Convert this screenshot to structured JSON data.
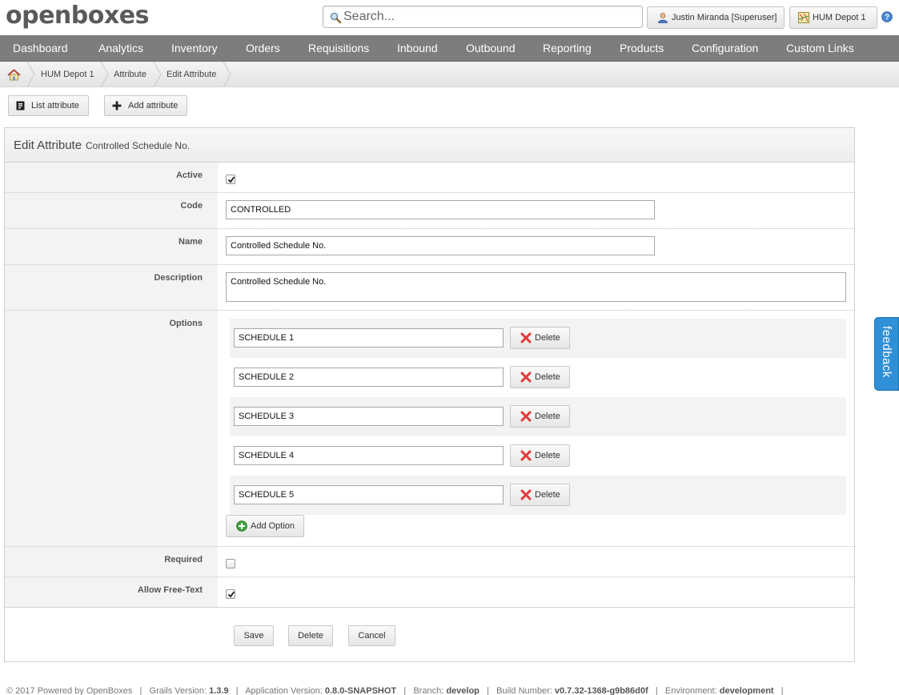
{
  "app": {
    "logo": "openboxes"
  },
  "search": {
    "placeholder": "Search..."
  },
  "header": {
    "user_label": "Justin Miranda [Superuser]",
    "location_label": "HUM Depot 1"
  },
  "nav": {
    "items": [
      "Dashboard",
      "Analytics",
      "Inventory",
      "Orders",
      "Requisitions",
      "Inbound",
      "Outbound",
      "Reporting",
      "Products",
      "Configuration",
      "Custom Links"
    ]
  },
  "breadcrumb": {
    "items": [
      "HUM Depot 1",
      "Attribute",
      "Edit Attribute"
    ]
  },
  "actions": {
    "list_label": "List attribute",
    "add_label": "Add attribute"
  },
  "form": {
    "title": "Edit Attribute",
    "subtitle": "Controlled Schedule No.",
    "labels": {
      "active": "Active",
      "code": "Code",
      "name": "Name",
      "description": "Description",
      "options": "Options",
      "required": "Required",
      "allow_free_text": "Allow Free-Text"
    },
    "values": {
      "active": true,
      "code": "CONTROLLED",
      "name": "Controlled Schedule No.",
      "description": "Controlled Schedule No.",
      "required": false,
      "allow_free_text": true
    },
    "options": [
      "SCHEDULE 1",
      "SCHEDULE 2",
      "SCHEDULE 3",
      "SCHEDULE 4",
      "SCHEDULE 5"
    ],
    "delete_option_label": "Delete",
    "add_option_label": "Add Option",
    "buttons": {
      "save": "Save",
      "delete": "Delete",
      "cancel": "Cancel"
    }
  },
  "feedback": {
    "label": "feedback"
  },
  "footer": {
    "copyright": "© 2017 Powered by OpenBoxes",
    "grails_label": "Grails Version:",
    "grails": "1.3.9",
    "app_version_label": "Application Version:",
    "app_version": "0.8.0-SNAPSHOT",
    "branch_label": "Branch:",
    "branch": "develop",
    "build_label": "Build Number:",
    "build": "v0.7.32-1368-g9b86d0f",
    "env_label": "Environment:",
    "env": "development"
  },
  "colors": {
    "nav_bg": "#7d7d7d",
    "feedback_bg": "#2f8fd7",
    "delete_x": "#e03a3a",
    "add_green": "#3aa33a"
  }
}
